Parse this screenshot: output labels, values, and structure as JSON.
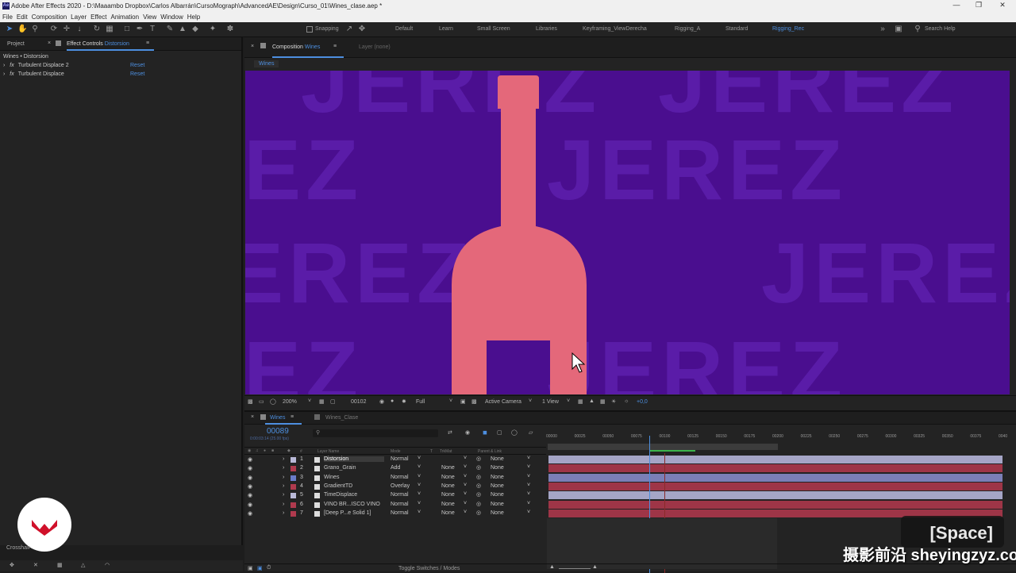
{
  "window": {
    "title": "Adobe After Effects 2020 - D:\\Maaambo Dropbox\\Carlos Albarrán\\CursoMograph\\AdvancedAE\\Design\\Curso_01\\Wines_clase.aep *",
    "app_icon": "Ae"
  },
  "menu": [
    "File",
    "Edit",
    "Composition",
    "Layer",
    "Effect",
    "Animation",
    "View",
    "Window",
    "Help"
  ],
  "toolbar": {
    "snapping_label": "Snapping",
    "workspaces": [
      "Default",
      "Learn",
      "Small Screen",
      "Libraries",
      "Keyframing_ViewDerecha",
      "Rigging_A",
      "Standard",
      "Rigging_Rec"
    ],
    "active_workspace": "Rigging_Rec",
    "search_placeholder": "Search Help"
  },
  "left_panel": {
    "tab_project": "Project",
    "tab_effect_controls": "Effect Controls",
    "effect_controls_layer": "Distorsion",
    "breadcrumb": "Wines • Distorsion",
    "effects": [
      {
        "name": "Turbulent Displace 2",
        "reset": "Reset"
      },
      {
        "name": "Turbulent Displace",
        "reset": "Reset"
      }
    ],
    "crosshair_label": "Crosshair"
  },
  "composition": {
    "tab_label": "Composition",
    "comp_name": "Wines",
    "layer_tab": "Layer (none)",
    "sub_tab": "Wines",
    "background_text": "JEREZ",
    "colors": {
      "bg": "#4a0e8f",
      "text": "#5a1ca8",
      "bottle": "#e4687a"
    }
  },
  "viewer_bar": {
    "zoom": "200%",
    "timecode": "00102",
    "resolution": "Full",
    "camera": "Active Camera",
    "views": "1 View",
    "exposure": "+0,0"
  },
  "timeline": {
    "tab_active": "Wines",
    "tab_other": "Wines_Clase",
    "current_time": "00089",
    "current_time_sub": "0:00:03:14 (25.00 fps)",
    "col_layer_name": "Layer Name",
    "col_mode": "Mode",
    "col_t": "T",
    "col_trkmat": "TrkMat",
    "col_parent": "Parent & Link",
    "ruler": [
      "00000",
      "00025",
      "00050",
      "00075",
      "00100",
      "00125",
      "00150",
      "00175",
      "00200",
      "00225",
      "00250",
      "00275",
      "00300",
      "00325",
      "00350",
      "00375",
      "0040"
    ],
    "layers": [
      {
        "num": "1",
        "name": "Distorsion",
        "mode": "Normal",
        "trkmat": "",
        "parent": "None",
        "label": "#b9b9d8",
        "bar": "#a5a5c6"
      },
      {
        "num": "2",
        "name": "Grano_Grain",
        "mode": "Add",
        "trkmat": "None",
        "parent": "None",
        "label": "#b03a4e",
        "bar": "#9e3547"
      },
      {
        "num": "3",
        "name": "Wines",
        "mode": "Normal",
        "trkmat": "None",
        "parent": "None",
        "label": "#6a7cc9",
        "bar": "#7b7fb6"
      },
      {
        "num": "4",
        "name": "GradientTD",
        "mode": "Overlay",
        "trkmat": "None",
        "parent": "None",
        "label": "#b03a4e",
        "bar": "#9e3547"
      },
      {
        "num": "5",
        "name": "TimeDisplace",
        "mode": "Normal",
        "trkmat": "None",
        "parent": "None",
        "label": "#b9b9d8",
        "bar": "#a5a5c6"
      },
      {
        "num": "6",
        "name": "VINO BR...ISCO VINO",
        "mode": "Normal",
        "trkmat": "None",
        "parent": "None",
        "label": "#b03a4e",
        "bar": "#9e3547"
      },
      {
        "num": "7",
        "name": "[Deep P...e Solid 1]",
        "mode": "Normal",
        "trkmat": "None",
        "parent": "None",
        "label": "#b03a4e",
        "bar": "#9e3547"
      }
    ],
    "toggle_label": "Toggle Switches / Modes"
  },
  "overlay": {
    "key_hint": "[Space]",
    "watermark": "摄影前沿 sheyingzyz.com"
  }
}
